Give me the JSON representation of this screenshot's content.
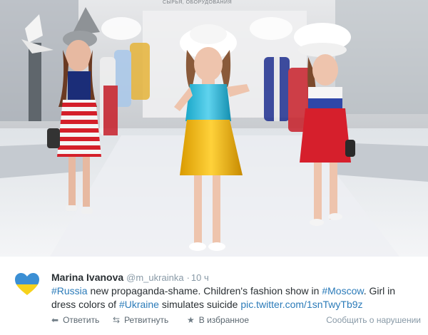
{
  "photo": {
    "watermark": "СЫРЬЯ, ОБОРУДОВАНИЯ"
  },
  "tweet": {
    "author": {
      "name": "Marina Ivanova",
      "handle": "@m_ukrainka",
      "separator": "·",
      "time": "10 ч",
      "avatar_icon": "heart-ukraine-flag-icon",
      "avatar_colors": {
        "top": "#3b8fd4",
        "bottom": "#f6d21c"
      }
    },
    "text": {
      "hashtag_russia": "#Russia",
      "part1": " new propaganda-shame. Children's fashion show in ",
      "hashtag_moscow": "#Moscow",
      "part2": ". Girl in dress colors of ",
      "hashtag_ukraine": "#Ukraine",
      "part3": " simulates suicide ",
      "link": "pic.twitter.com/1snTwyTb9z"
    },
    "actions": {
      "reply": {
        "label": "Ответить",
        "icon": "reply-icon"
      },
      "retweet": {
        "label": "Ретвитнуть",
        "icon": "retweet-icon"
      },
      "favorite": {
        "label": "В избранное",
        "icon": "star-icon"
      },
      "report": "Сообщить о нарушении"
    },
    "link_color": "#2b7bb9"
  }
}
